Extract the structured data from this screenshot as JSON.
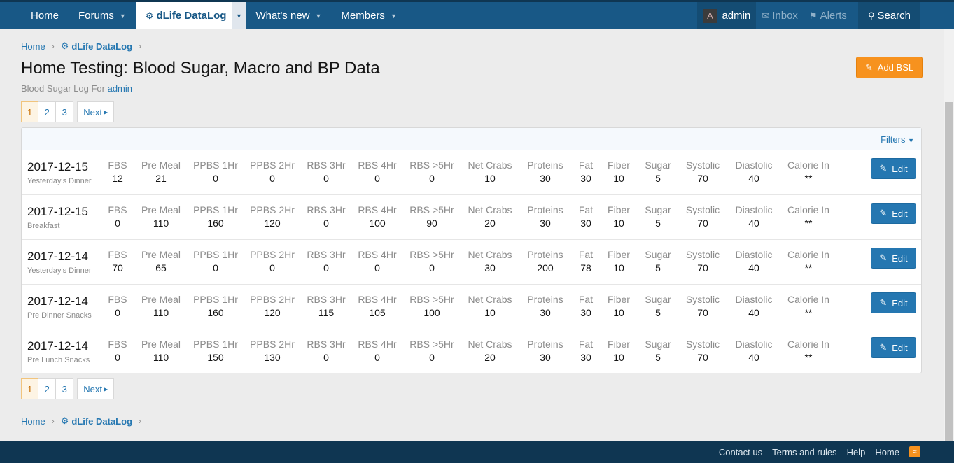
{
  "nav": {
    "items": [
      {
        "label": "Home",
        "caret": false
      },
      {
        "label": "Forums",
        "caret": true
      },
      {
        "label": "dLife DataLog",
        "caret": true,
        "active": true
      },
      {
        "label": "What's new",
        "caret": true
      },
      {
        "label": "Members",
        "caret": true
      }
    ],
    "user": {
      "avatar_letter": "A",
      "name": "admin"
    },
    "inbox": "Inbox",
    "alerts": "Alerts",
    "search": "Search"
  },
  "breadcrumb": {
    "home": "Home",
    "section": "dLife DataLog"
  },
  "page": {
    "title": "Home Testing: Blood Sugar, Macro and BP Data",
    "subtitle_prefix": "Blood Sugar Log For",
    "subtitle_user": "admin",
    "add_button": "Add BSL"
  },
  "pagination": {
    "pages": [
      "1",
      "2",
      "3"
    ],
    "current": "1",
    "next": "Next"
  },
  "filters_label": "Filters",
  "columns": [
    "FBS",
    "Pre Meal",
    "PPBS 1Hr",
    "PPBS 2Hr",
    "RBS 3Hr",
    "RBS 4Hr",
    "RBS >5Hr",
    "Net Crabs",
    "Proteins",
    "Fat",
    "Fiber",
    "Sugar",
    "Systolic",
    "Diastolic",
    "Calorie In"
  ],
  "edit_label": "Edit",
  "entries": [
    {
      "date": "2017-12-15",
      "meal": "Yesterday's Dinner",
      "values": [
        "12",
        "21",
        "0",
        "0",
        "0",
        "0",
        "0",
        "10",
        "30",
        "30",
        "10",
        "5",
        "70",
        "40",
        "**"
      ]
    },
    {
      "date": "2017-12-15",
      "meal": "Breakfast",
      "values": [
        "0",
        "110",
        "160",
        "120",
        "0",
        "100",
        "90",
        "20",
        "30",
        "30",
        "10",
        "5",
        "70",
        "40",
        "**"
      ]
    },
    {
      "date": "2017-12-14",
      "meal": "Yesterday's Dinner",
      "values": [
        "70",
        "65",
        "0",
        "0",
        "0",
        "0",
        "0",
        "30",
        "200",
        "78",
        "10",
        "5",
        "70",
        "40",
        "**"
      ]
    },
    {
      "date": "2017-12-14",
      "meal": "Pre Dinner Snacks",
      "values": [
        "0",
        "110",
        "160",
        "120",
        "115",
        "105",
        "100",
        "10",
        "30",
        "30",
        "10",
        "5",
        "70",
        "40",
        "**"
      ]
    },
    {
      "date": "2017-12-14",
      "meal": "Pre Lunch Snacks",
      "values": [
        "0",
        "110",
        "150",
        "130",
        "0",
        "0",
        "0",
        "20",
        "30",
        "30",
        "10",
        "5",
        "70",
        "40",
        "**"
      ]
    }
  ],
  "footer": {
    "links": [
      "Contact us",
      "Terms and rules",
      "Help",
      "Home"
    ]
  }
}
